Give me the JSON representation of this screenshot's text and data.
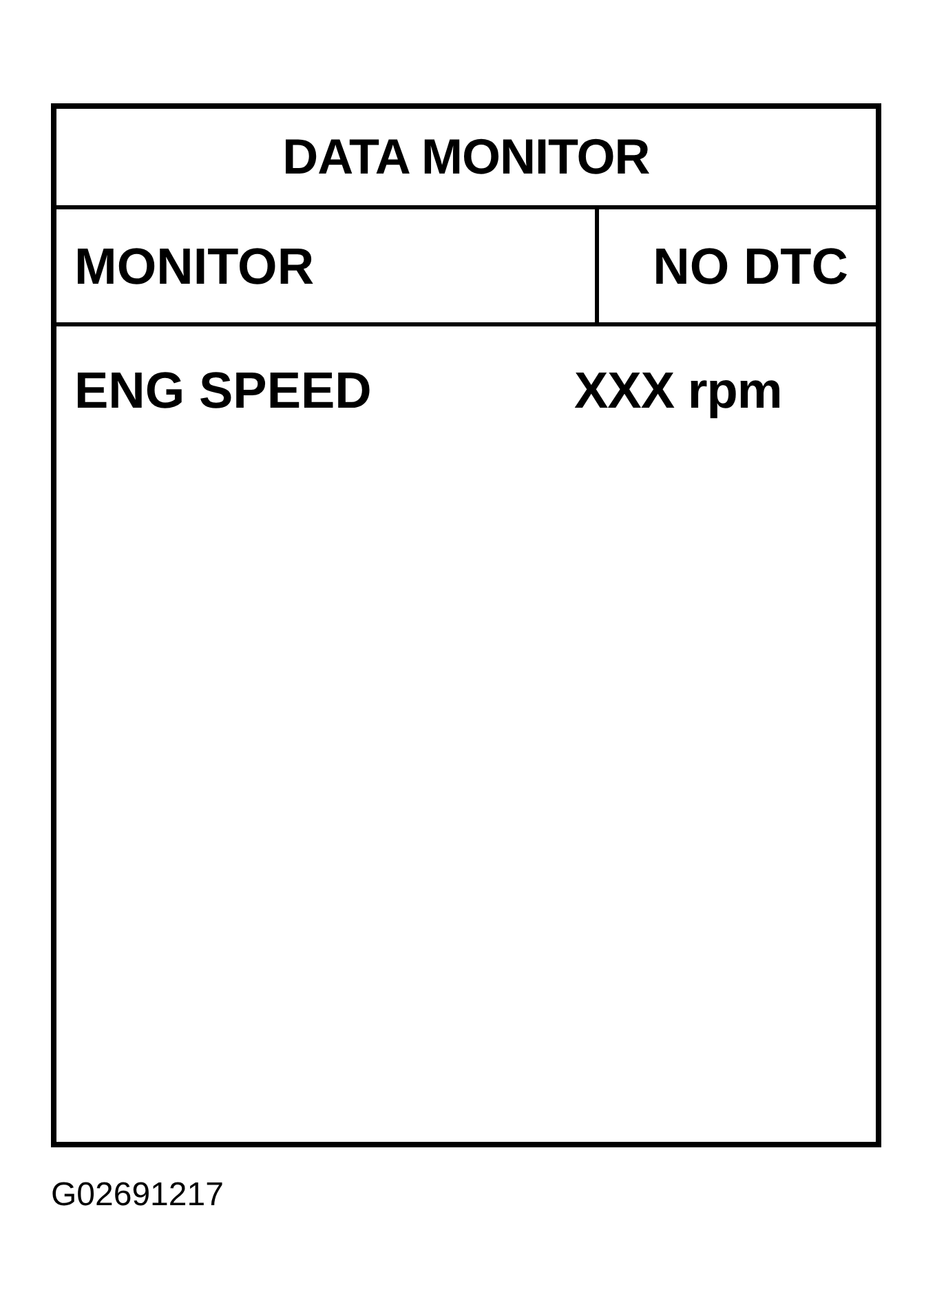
{
  "title": "DATA MONITOR",
  "header": {
    "mode": "MONITOR",
    "status": "NO DTC"
  },
  "rows": [
    {
      "label": "ENG SPEED",
      "value": "XXX rpm"
    }
  ],
  "figure_code": "G02691217"
}
